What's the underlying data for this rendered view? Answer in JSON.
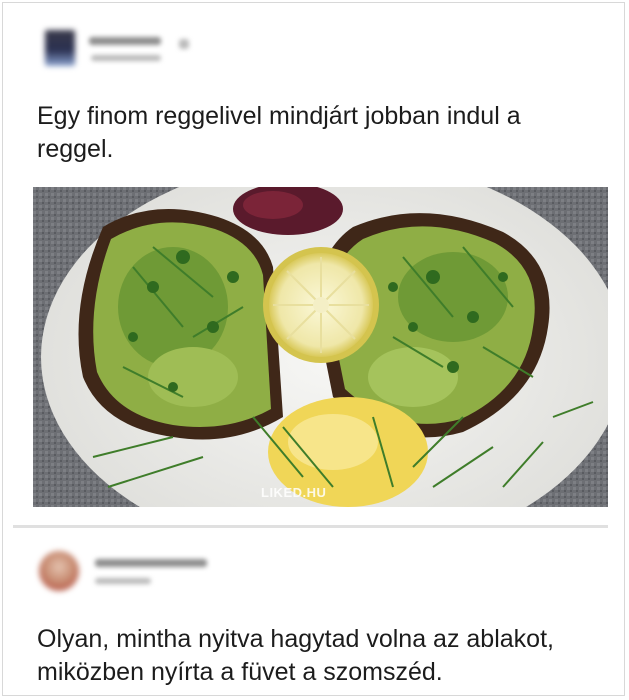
{
  "post": {
    "text": "Egy finom reggelivel mindjárt jobban indul a reggel.",
    "image": {
      "watermark": "LIKED.HU",
      "description_icon": "breakfast-photo"
    }
  },
  "reply": {
    "text": "Olyan, mintha nyitva hagytad volna az ablakot, miközben nyírta a füvet a szomszéd."
  },
  "colors": {
    "text": "#1c1c1c",
    "divider": "#e0e0e0",
    "avocado": "#8fae45",
    "herb": "#3f7d2a",
    "bread": "#4a2f1e",
    "plate": "#efefed"
  }
}
